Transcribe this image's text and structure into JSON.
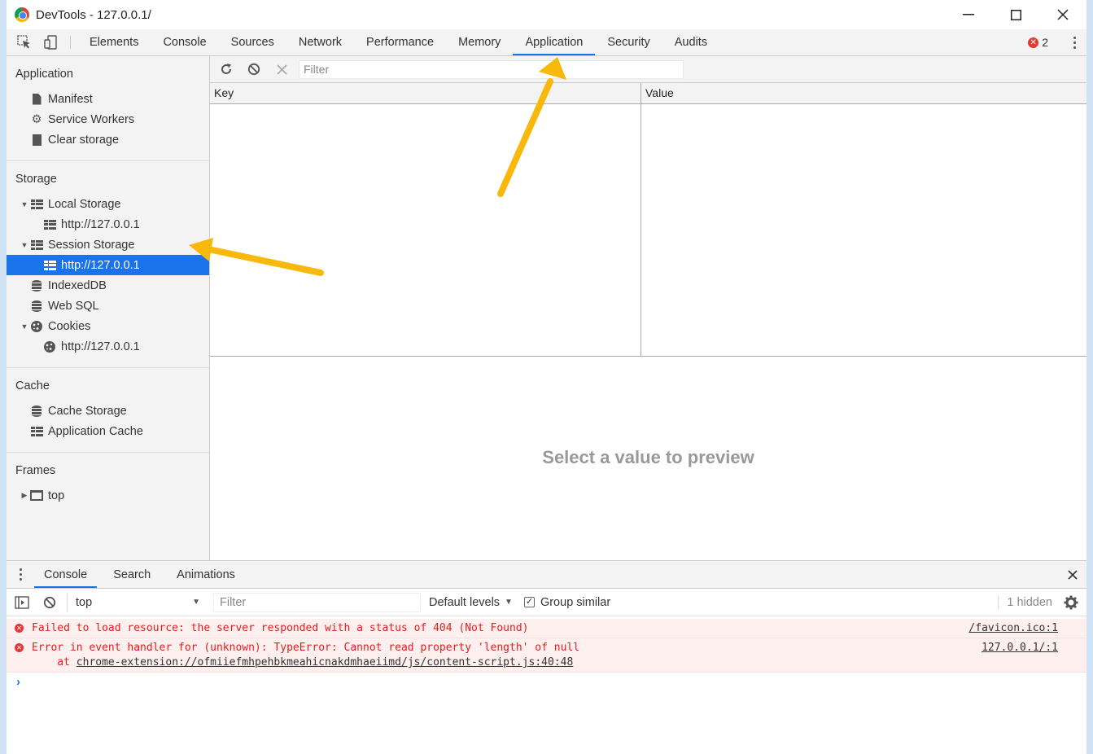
{
  "window": {
    "title": "DevTools - 127.0.0.1/"
  },
  "tabs": [
    "Elements",
    "Console",
    "Sources",
    "Network",
    "Performance",
    "Memory",
    "Application",
    "Security",
    "Audits"
  ],
  "active_tab": "Application",
  "error_count": "2",
  "sidebar": {
    "application": {
      "title": "Application",
      "items": [
        "Manifest",
        "Service Workers",
        "Clear storage"
      ]
    },
    "storage": {
      "title": "Storage",
      "local_storage": "Local Storage",
      "local_origin": "http://127.0.0.1",
      "session_storage": "Session Storage",
      "session_origin": "http://127.0.0.1",
      "indexeddb": "IndexedDB",
      "websql": "Web SQL",
      "cookies": "Cookies",
      "cookies_origin": "http://127.0.0.1"
    },
    "cache": {
      "title": "Cache",
      "items": [
        "Cache Storage",
        "Application Cache"
      ]
    },
    "frames": {
      "title": "Frames",
      "top": "top"
    }
  },
  "storage_panel": {
    "filter_placeholder": "Filter",
    "col_key": "Key",
    "col_value": "Value",
    "preview_message": "Select a value to preview"
  },
  "drawer": {
    "tabs": [
      "Console",
      "Search",
      "Animations"
    ],
    "context": "top",
    "filter_placeholder": "Filter",
    "levels": "Default levels",
    "group_similar": "Group similar",
    "hidden": "1 hidden",
    "messages": [
      {
        "text": "Failed to load resource: the server responded with a status of 404 (Not Found)",
        "source": "/favicon.ico:1"
      },
      {
        "text": "Error in event handler for (unknown): TypeError: Cannot read property 'length' of null",
        "at_prefix": "    at ",
        "at_link": "chrome-extension://ofmiiefmhpehbkmeahicnakdmhaeiimd/js/content-script.js:40:48",
        "source": "127.0.0.1/:1"
      }
    ]
  },
  "colors": {
    "accent": "#1a73e8",
    "error": "#e0201f",
    "arrow": "#f9b90c"
  },
  "icons": [
    "inspect-icon",
    "device-icon",
    "refresh-icon",
    "clear-icon",
    "delete-icon",
    "gear-icon",
    "close-icon"
  ]
}
